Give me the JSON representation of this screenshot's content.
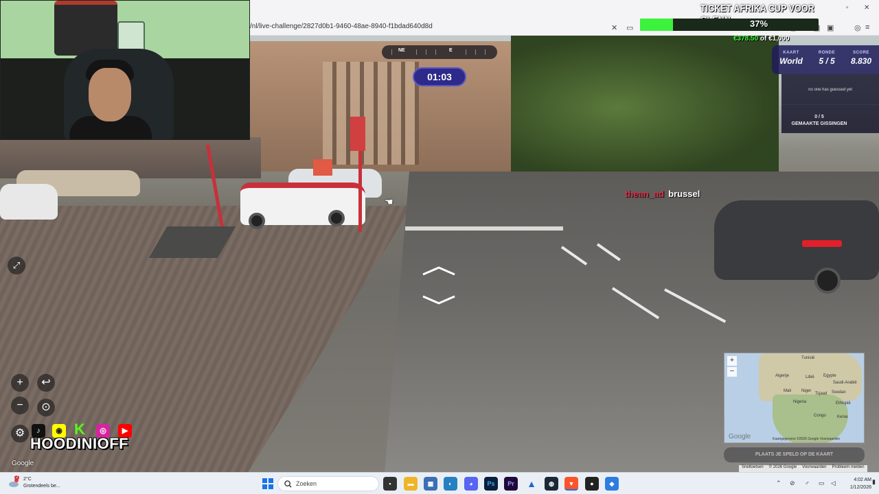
{
  "browser": {
    "url": "/nl/live-challenge/2827d0b1-9460-48ae-8940-f1bdad640d8d"
  },
  "stream": {
    "goal_title": "TICKET AFRIKA CUP VOOR GLENN",
    "goal_progress_pct": 37,
    "goal_progress_label": "37%",
    "raised": "€378.50",
    "raised_sep": " of ",
    "goal_amount": "€1,000",
    "streamer_name": "HOODINIOFF",
    "progress_color": "#3cf23c"
  },
  "game": {
    "map_label": "KAART",
    "map_value": "World",
    "round_label": "RONDE",
    "round_value": "5 / 5",
    "score_label": "SCORE",
    "score_value": "8.830",
    "no_guess_text": "no one has guessed yet",
    "guess_count": "0 / 5",
    "guess_label": "GEMAAKTE GISSINGEN",
    "timer": "01:03",
    "compass_dirs": [
      "NE",
      "E"
    ],
    "place_button": "PLAATS JE SPELD OP DE KAART",
    "accent_color": "#2e2a8a"
  },
  "chat": {
    "user": "thean_ad",
    "message": "brussel"
  },
  "controls": {
    "zoom_in": "+",
    "zoom_out": "−",
    "undo": "↩",
    "pin": "⊙",
    "settings": "⚙",
    "fullscreen": "⤢"
  },
  "street_view": {
    "google_watermark": "Google",
    "footer": [
      "Sneltoetsen",
      "© 2026 Google",
      "Voorwaarden",
      "Probleem melden"
    ]
  },
  "minimap": {
    "labels": [
      "Algerije",
      "Libië",
      "Egypte",
      "Mali",
      "Niger",
      "Tsjaad",
      "Soedan",
      "Nigeria",
      "Ethiopië",
      "Congo",
      "Kenia",
      "Tunisië",
      "Saudi-Arabië"
    ],
    "google": "Google",
    "attribution": "Kaartgegevens ©2026 Google  Voorwaarden"
  },
  "taskbar": {
    "weather_temp": "2°C",
    "weather_text": "Grotendeels be...",
    "search_placeholder": "Zoeken",
    "time": "4:02 AM",
    "date": "1/12/2026",
    "notification_count": "2"
  }
}
